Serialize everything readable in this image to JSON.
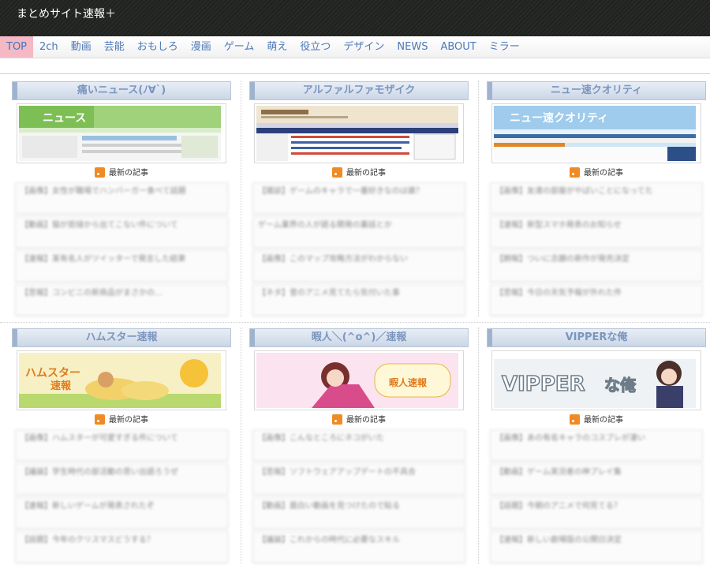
{
  "site": {
    "title": "まとめサイト速報＋"
  },
  "nav": {
    "items": [
      {
        "label": "TOP",
        "active": true
      },
      {
        "label": "2ch"
      },
      {
        "label": "動画"
      },
      {
        "label": "芸能"
      },
      {
        "label": "おもしろ"
      },
      {
        "label": "漫画"
      },
      {
        "label": "ゲーム"
      },
      {
        "label": "萌え"
      },
      {
        "label": "役立つ"
      },
      {
        "label": "デザイン"
      },
      {
        "label": "NEWS"
      },
      {
        "label": "ABOUT"
      },
      {
        "label": "ミラー"
      }
    ]
  },
  "colors": {
    "nav_text": "#4d78b8",
    "nav_active_bg": "#f4b9c4",
    "header_bg": "#242724",
    "blog_head_text": "#7b95bf",
    "rss": "#f08a24"
  },
  "blogs": [
    {
      "name": "痛いニュース(ﾉ∀`)",
      "latest_label": "最新の記事",
      "entries": [
        "【画像】女性が職場でハンバーガー食べて話題",
        "【動画】猫が炬燵から出てこない件について",
        "【速報】某有名人がツイッターで発言した結果",
        "【悲報】コンビニの新商品がまさかの…"
      ]
    },
    {
      "name": "アルファルファモザイク",
      "latest_label": "最新の記事",
      "entries": [
        "【雑談】ゲームのキャラで一番好きなのは誰？",
        "ゲーム業界の人が語る開発の裏話とか",
        "【画像】このマップ攻略方法がわからない",
        "【ネタ】昔のアニメ見てたら気付いた事"
      ]
    },
    {
      "name": "ニュー速クオリティ",
      "latest_label": "最新の記事",
      "entries": [
        "【画像】友達の部屋がやばいことになってた",
        "【速報】新型スマホ発表のお知らせ",
        "【朗報】ついに念願の新作が発売決定",
        "【悲報】今日の天気予報が外れた件"
      ]
    },
    {
      "name": "ハムスター速報",
      "latest_label": "最新の記事",
      "entries": [
        "【画像】ハムスターが可愛すぎる件について",
        "【議論】学生時代の部活動の思い出語ろうぜ",
        "【速報】新しいゲームが発表されたぞ",
        "【話題】今年のクリスマスどうする？"
      ]
    },
    {
      "name": "暇人＼(^o^)／速報",
      "latest_label": "最新の記事",
      "entries": [
        "【画像】こんなところにネコがいた",
        "【悲報】ソフトウェアアップデートの不具合",
        "【動画】面白い動画を見つけたので貼る",
        "【議論】これからの時代に必要なスキル"
      ]
    },
    {
      "name": "VIPPERな俺",
      "latest_label": "最新の記事",
      "entries": [
        "【画像】あの有名キャラのコスプレが凄い",
        "【動画】ゲーム実況者の神プレイ集",
        "【話題】今期のアニメで何見てる？",
        "【速報】新しい劇場版の公開日決定"
      ]
    }
  ]
}
